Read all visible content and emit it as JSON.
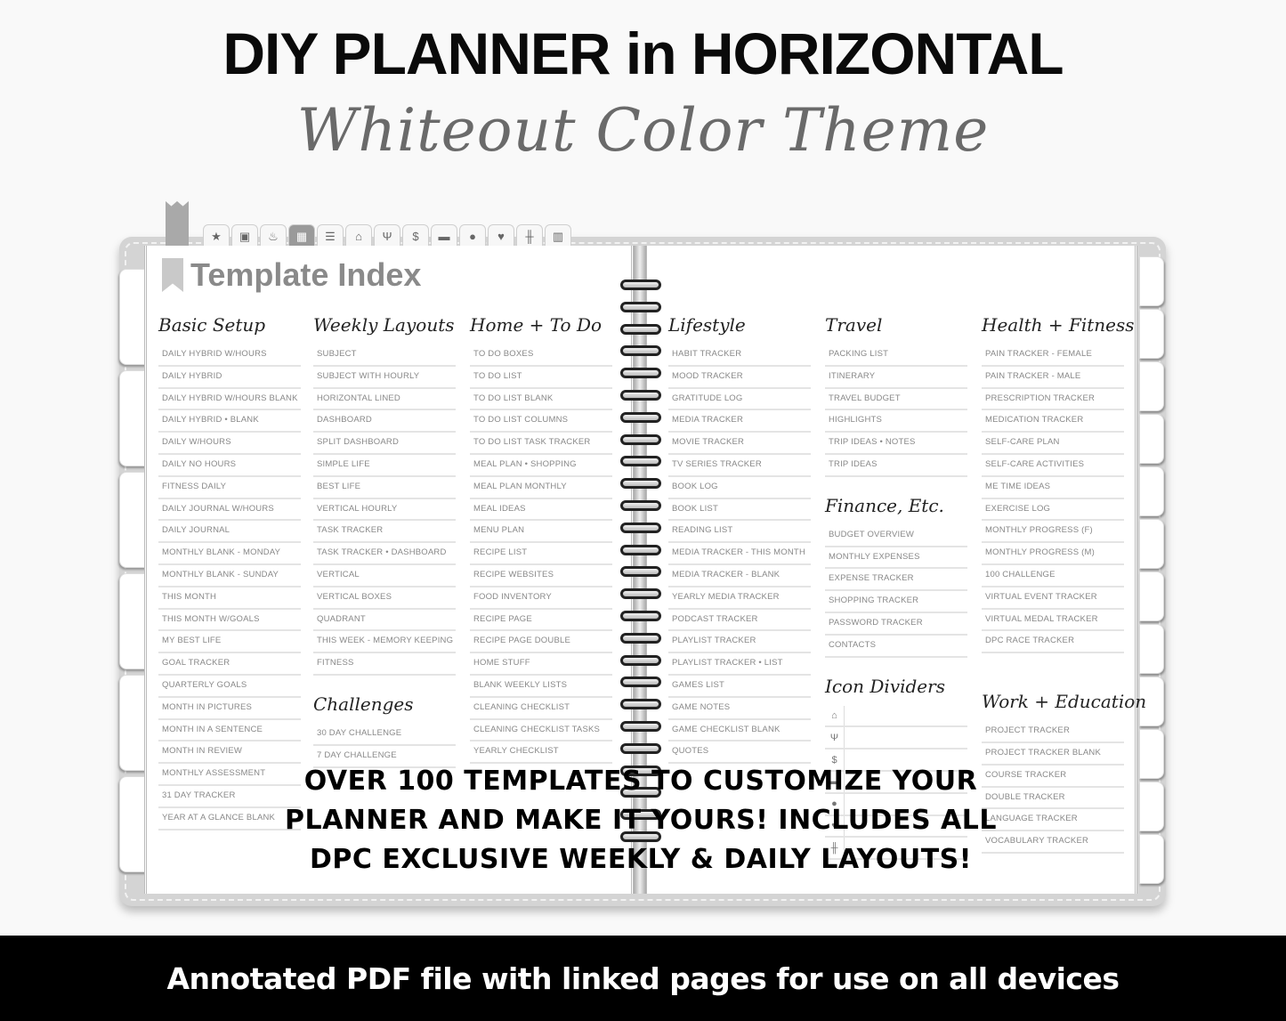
{
  "hero": {
    "title": "DIY  PLANNER in HORIZONTAL",
    "subtitle": "Whiteout Color Theme"
  },
  "top_tabs": [
    {
      "icon": "star-icon",
      "glyph": "★",
      "active": false
    },
    {
      "icon": "calendar-icon",
      "glyph": "▣",
      "active": false
    },
    {
      "icon": "cake-icon",
      "glyph": "♨",
      "active": false
    },
    {
      "icon": "grid-icon",
      "glyph": "▦",
      "active": true
    },
    {
      "icon": "list-icon",
      "glyph": "☰",
      "active": false
    },
    {
      "icon": "home-icon",
      "glyph": "⌂",
      "active": false
    },
    {
      "icon": "utensils-icon",
      "glyph": "Ψ",
      "active": false
    },
    {
      "icon": "dollar-icon",
      "glyph": "$",
      "active": false
    },
    {
      "icon": "folder-icon",
      "glyph": "▬",
      "active": false
    },
    {
      "icon": "map-pin-icon",
      "glyph": "●",
      "active": false
    },
    {
      "icon": "heart-icon",
      "glyph": "♥",
      "active": false
    },
    {
      "icon": "dumbbell-icon",
      "glyph": "╫",
      "active": false
    },
    {
      "icon": "books-icon",
      "glyph": "▥",
      "active": false
    }
  ],
  "page_title": "Template Index",
  "columns": {
    "basic_setup": {
      "heading": "Basic Setup",
      "items": [
        "DAILY HYBRID W/HOURS",
        "DAILY HYBRID",
        "DAILY HYBRID W/HOURS BLANK",
        "DAILY HYBRID • BLANK",
        "DAILY W/HOURS",
        "DAILY NO HOURS",
        "FITNESS DAILY",
        "DAILY JOURNAL W/HOURS",
        "DAILY JOURNAL",
        "MONTHLY BLANK - MONDAY",
        "MONTHLY BLANK - SUNDAY",
        "THIS MONTH",
        "THIS MONTH W/GOALS",
        "MY BEST LIFE",
        "GOAL TRACKER",
        "QUARTERLY GOALS",
        "MONTH IN PICTURES",
        "MONTH IN A SENTENCE",
        "MONTH IN REVIEW",
        "MONTHLY ASSESSMENT",
        "31 DAY TRACKER",
        "YEAR AT A GLANCE BLANK"
      ]
    },
    "weekly_layouts": {
      "heading": "Weekly Layouts",
      "items": [
        "SUBJECT",
        "SUBJECT WITH HOURLY",
        "HORIZONTAL LINED",
        "DASHBOARD",
        "SPLIT DASHBOARD",
        "SIMPLE LIFE",
        "BEST LIFE",
        "VERTICAL HOURLY",
        "TASK TRACKER",
        "TASK TRACKER • DASHBOARD",
        "VERTICAL",
        "VERTICAL BOXES",
        "QUADRANT",
        "THIS WEEK - MEMORY KEEPING",
        "FITNESS"
      ]
    },
    "challenges": {
      "heading": "Challenges",
      "items": [
        "30 DAY CHALLENGE",
        "7 DAY CHALLENGE"
      ]
    },
    "home_todo": {
      "heading": "Home + To Do",
      "items": [
        "TO DO BOXES",
        "TO DO LIST",
        "TO DO LIST BLANK",
        "TO DO LIST COLUMNS",
        "TO DO LIST TASK TRACKER",
        "MEAL PLAN • SHOPPING",
        "MEAL PLAN MONTHLY",
        "MEAL IDEAS",
        "MENU PLAN",
        "RECIPE LIST",
        "RECIPE WEBSITES",
        "FOOD INVENTORY",
        "RECIPE PAGE",
        "RECIPE PAGE DOUBLE",
        "HOME STUFF",
        "BLANK WEEKLY LISTS",
        "CLEANING CHECKLIST",
        "CLEANING CHECKLIST TASKS",
        "YEARLY CHECKLIST"
      ]
    },
    "lifestyle": {
      "heading": "Lifestyle",
      "items": [
        "HABIT TRACKER",
        "MOOD TRACKER",
        "GRATITUDE LOG",
        "MEDIA TRACKER",
        "MOVIE TRACKER",
        "TV SERIES TRACKER",
        "BOOK LOG",
        "BOOK LIST",
        "READING LIST",
        "MEDIA TRACKER - THIS MONTH",
        "MEDIA TRACKER - BLANK",
        "YEARLY MEDIA TRACKER",
        "PODCAST TRACKER",
        "PLAYLIST TRACKER",
        "PLAYLIST TRACKER • LIST",
        "GAMES LIST",
        "GAME NOTES",
        "GAME CHECKLIST BLANK",
        "QUOTES"
      ]
    },
    "travel": {
      "heading": "Travel",
      "items": [
        "PACKING LIST",
        "ITINERARY",
        "TRAVEL BUDGET",
        "HIGHLIGHTS",
        "TRIP IDEAS • NOTES",
        "TRIP IDEAS"
      ]
    },
    "finance": {
      "heading": "Finance, Etc.",
      "items": [
        "BUDGET OVERVIEW",
        "MONTHLY EXPENSES",
        "EXPENSE TRACKER",
        "SHOPPING TRACKER",
        "PASSWORD TRACKER",
        "CONTACTS"
      ]
    },
    "icon_dividers": {
      "heading": "Icon Dividers",
      "icons": [
        {
          "name": "home-icon",
          "glyph": "⌂"
        },
        {
          "name": "utensils-icon",
          "glyph": "Ψ"
        },
        {
          "name": "dollar-icon",
          "glyph": "$"
        },
        {
          "name": "folder-icon",
          "glyph": "▬"
        },
        {
          "name": "map-pin-icon",
          "glyph": "●"
        },
        {
          "name": "heart-icon",
          "glyph": "♥"
        },
        {
          "name": "dumbbell-icon",
          "glyph": "╫"
        }
      ]
    },
    "health_fitness": {
      "heading": "Health + Fitness",
      "items": [
        "PAIN TRACKER - FEMALE",
        "PAIN TRACKER - MALE",
        "PRESCRIPTION TRACKER",
        "MEDICATION TRACKER",
        "SELF-CARE PLAN",
        "SELF-CARE ACTIVITIES",
        "ME TIME IDEAS",
        "EXERCISE LOG",
        "MONTHLY PROGRESS (F)",
        "MONTHLY PROGRESS (M)",
        "100 CHALLENGE",
        "VIRTUAL EVENT TRACKER",
        "VIRTUAL MEDAL TRACKER",
        "DPC RACE TRACKER"
      ]
    },
    "work_education": {
      "heading": "Work + Education",
      "items": [
        "PROJECT TRACKER",
        "PROJECT TRACKER BLANK",
        "COURSE TRACKER",
        "DOUBLE TRACKER",
        "LANGUAGE TRACKER",
        "VOCABULARY TRACKER"
      ]
    }
  },
  "overlay_text": {
    "line1": "OVER 100 TEMPLATES TO CUSTOMIZE YOUR",
    "line2": "PLANNER AND MAKE IT YOURS! INCLUDES ALL",
    "line3": "DPC EXCLUSIVE WEEKLY & DAILY LAYOUTS!"
  },
  "footer": {
    "text": "Annotated PDF file with linked pages for use on all devices"
  },
  "colors": {
    "cover": "#d4d4d4",
    "active_tab": "#9a9a9a",
    "item_text": "#888888",
    "footer_bg": "#000000"
  }
}
